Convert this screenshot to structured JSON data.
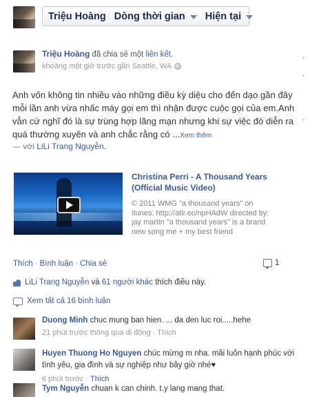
{
  "header": {
    "profile_name": "Triệu Hoàng",
    "timeline_label": "Dòng thời gian",
    "current_label": "Hiện tại"
  },
  "post": {
    "author": "Triệu Hoàng",
    "action_text": "đã chia sẻ một",
    "action_link": "liên kết.",
    "time_location": "khoảng một giờ trước gần Seattle, WA",
    "body": "Anh vốn không tin nhiều vào những điều kỳ diệu cho đến dạo gần đây mỗi lần anh vừa nhấc máy gọi em thì nhận được cuộc gọi của em.Anh vẫn cứ nghĩ đó là sự trùng hợp lãng mạn nhưng khi sự việc đó diễn ra quá thường xuyên và anh chắc rằng có ...",
    "see_more": "Xem thêm",
    "tag_prefix": "— với",
    "tag_name": "LiLi Trang Nguyễn",
    "tag_suffix": "."
  },
  "video": {
    "title": "Christina Perri - A Thousand Years (Official Music Video)",
    "description": "© 2011 WMG \"a thousand years\" on itunes: http://atlr.ec/npHAdW directed by: jay martin \"a thousand years\" is a brand new song me + my best friend"
  },
  "actions": {
    "like": "Thích",
    "comment": "Bình luận",
    "share": "Chia sẻ",
    "comment_count": "1"
  },
  "likes": {
    "name": "LiLi Trang Nguyễn",
    "connector": "và",
    "others": "61 người khác",
    "suffix": "thích điều này."
  },
  "view_all": "Xem tất cả 16 bình luận",
  "comments": [
    {
      "author": "Duong Minh",
      "text": "chuc mung ban hien. ... da den luc roi.....hehe",
      "meta": "21 phút trước thông qua di động · Thích"
    },
    {
      "author": "Huyen Thuong Ho Nguyen",
      "text": "chúc mừng m nha. mãi luôn hạnh phúc với tình yêu, gia đình và sự nghiệp như bây giờ nhé♥",
      "meta_time": "6 phút trước",
      "meta_like": "Thích"
    },
    {
      "author": "Tym Nguyễn",
      "text": "chuan k can chinh. t.y lang mang that."
    }
  ]
}
